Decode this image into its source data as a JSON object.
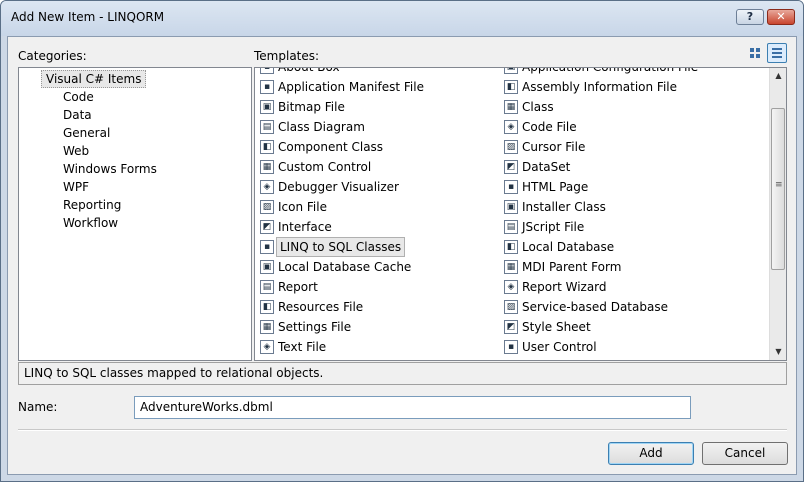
{
  "window": {
    "title": "Add New Item - LINQORM",
    "help_label": "?",
    "close_label": "✕"
  },
  "labels": {
    "categories": "Categories:",
    "templates": "Templates:",
    "name": "Name:"
  },
  "categories": {
    "root": "Visual C# Items",
    "items": [
      "Code",
      "Data",
      "General",
      "Web",
      "Windows Forms",
      "WPF",
      "Reporting",
      "Workflow"
    ]
  },
  "templates": {
    "left_partial": "About Box",
    "right_partial": "Application Configuration File",
    "left": [
      {
        "label": "Application Manifest File",
        "icon": "manifest-icon"
      },
      {
        "label": "Bitmap File",
        "icon": "bitmap-icon"
      },
      {
        "label": "Class Diagram",
        "icon": "class-diagram-icon"
      },
      {
        "label": "Component Class",
        "icon": "component-icon"
      },
      {
        "label": "Custom Control",
        "icon": "custom-control-icon"
      },
      {
        "label": "Debugger Visualizer",
        "icon": "debugger-icon"
      },
      {
        "label": "Icon File",
        "icon": "icon-file-icon"
      },
      {
        "label": "Interface",
        "icon": "interface-icon"
      },
      {
        "label": "LINQ to SQL Classes",
        "icon": "linq-icon",
        "selected": true
      },
      {
        "label": "Local Database Cache",
        "icon": "db-cache-icon"
      },
      {
        "label": "Report",
        "icon": "report-icon"
      },
      {
        "label": "Resources File",
        "icon": "resources-icon"
      },
      {
        "label": "Settings File",
        "icon": "settings-icon"
      },
      {
        "label": "Text File",
        "icon": "text-file-icon"
      }
    ],
    "right": [
      {
        "label": "Assembly Information File",
        "icon": "assembly-icon"
      },
      {
        "label": "Class",
        "icon": "class-icon"
      },
      {
        "label": "Code File",
        "icon": "code-file-icon"
      },
      {
        "label": "Cursor File",
        "icon": "cursor-icon"
      },
      {
        "label": "DataSet",
        "icon": "dataset-icon"
      },
      {
        "label": "HTML Page",
        "icon": "html-icon"
      },
      {
        "label": "Installer Class",
        "icon": "installer-icon"
      },
      {
        "label": "JScript File",
        "icon": "jscript-icon"
      },
      {
        "label": "Local Database",
        "icon": "local-db-icon"
      },
      {
        "label": "MDI Parent Form",
        "icon": "mdi-icon"
      },
      {
        "label": "Report Wizard",
        "icon": "report-wizard-icon"
      },
      {
        "label": "Service-based Database",
        "icon": "service-db-icon"
      },
      {
        "label": "Style Sheet",
        "icon": "stylesheet-icon"
      },
      {
        "label": "User Control",
        "icon": "user-control-icon"
      }
    ]
  },
  "description": "LINQ to SQL classes mapped to relational objects.",
  "name_value": "AdventureWorks.dbml",
  "buttons": {
    "add": "Add",
    "cancel": "Cancel"
  }
}
